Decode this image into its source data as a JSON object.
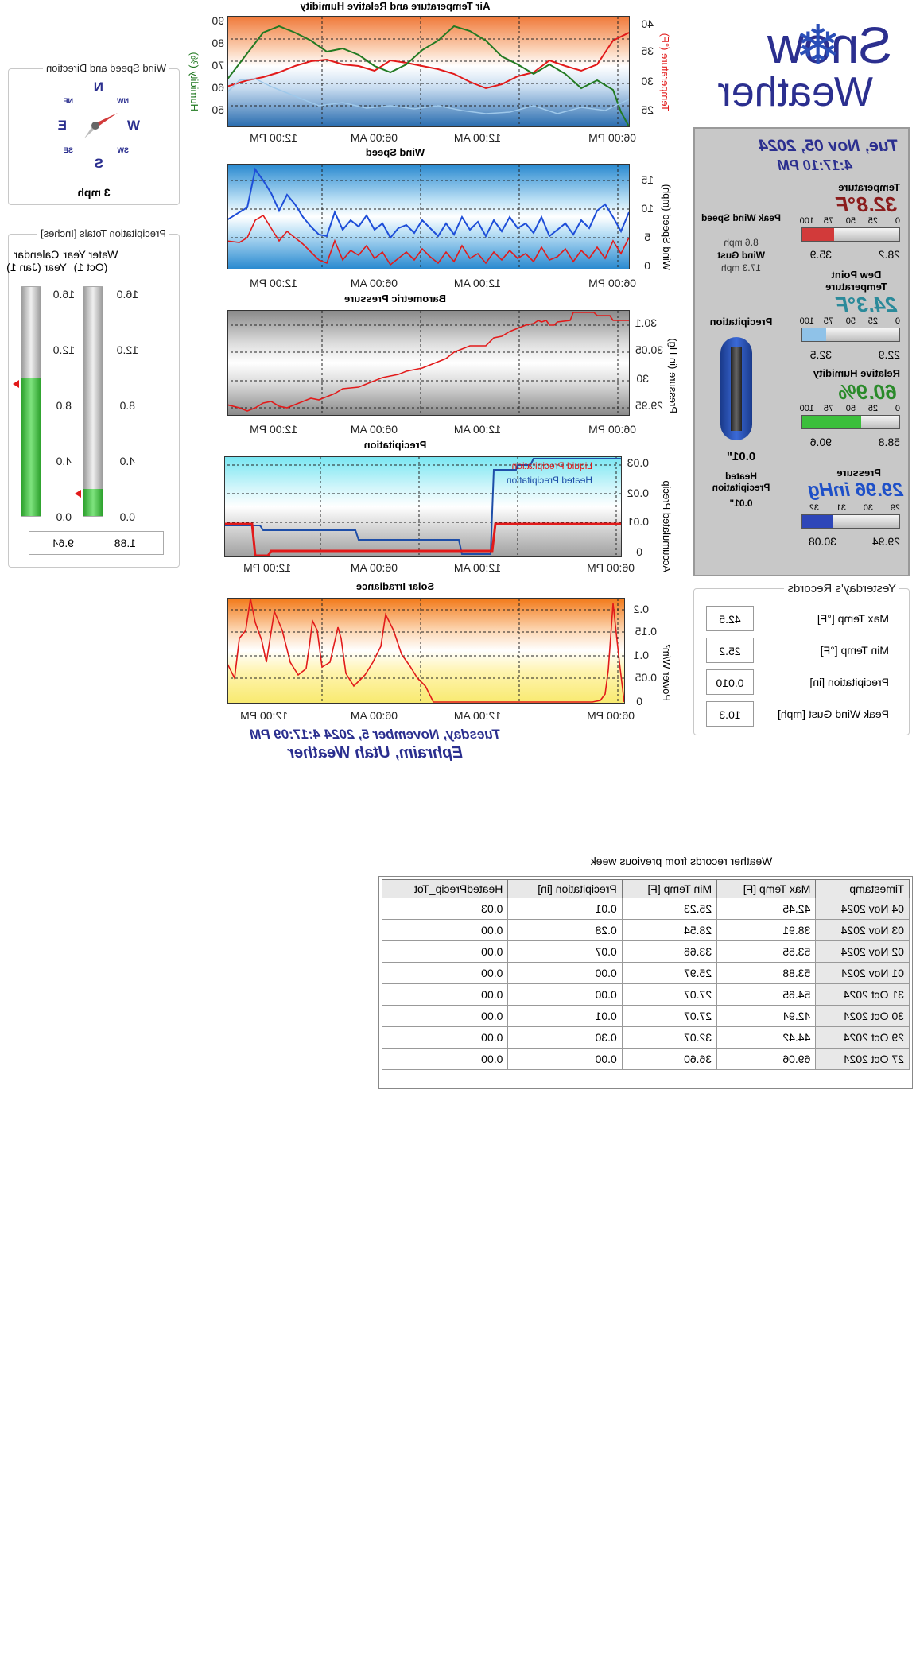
{
  "colors": {
    "navy": "#2b2f8f",
    "temp_red": "#8b1c1c",
    "teal": "#2a8a9a",
    "green": "#2a8a2a",
    "blue": "#1e50c8"
  },
  "logo": {
    "word1": "Snow",
    "word2": "Weather"
  },
  "wind_panel": {
    "title": "Wind Speed and Direction",
    "speed": "3 mph",
    "compass": {
      "n": "N",
      "s": "S",
      "e": "E",
      "w": "W",
      "ne": "NE",
      "nw": "NW",
      "se": "SE",
      "sw": "SW"
    }
  },
  "precip_totals": {
    "title": "Precipitation Totals [Inches]",
    "water_year_label": "Water Year (Oct 1)",
    "calendar_label": "Calendar Year (Jan 1)",
    "ticks": [
      "16.0",
      "12.0",
      "8.0",
      "4.0",
      "0.0"
    ],
    "water_year_value": "1.88",
    "calendar_value": "9.64",
    "water_year_fill": 0.118,
    "calendar_fill": 0.603
  },
  "charts": {
    "temp_title": "Air Temperature and Relative Humidity",
    "temp_left_label": "Temperature (°F)",
    "temp_right_label": "Humidity (%)",
    "temp_left_ticks": [
      "40",
      "35",
      "30",
      "25"
    ],
    "temp_right_ticks": [
      "90",
      "80",
      "70",
      "60",
      "50"
    ],
    "wind_title": "Wind Speed",
    "wind_left_label": "Wind Speed (mph)",
    "wind_left_ticks": [
      "15",
      "10",
      "5",
      "0"
    ],
    "baro_title": "Barometric Pressure",
    "baro_left_label": "Pressure (in Hg)",
    "baro_left_ticks": [
      "30.1",
      "30.05",
      "30",
      "29.95"
    ],
    "precip_title": "Precipitation",
    "precip_left_label": "Accumulated Precip",
    "precip_left_ticks": [
      "0.03",
      "0.02",
      "0.01",
      "0"
    ],
    "precip_legend_liquid": "Liquid Precipitation",
    "precip_legend_heated": "Heated Precipitation",
    "solar_title": "Solar Irradiance",
    "solar_left_label": "Power W/m²",
    "solar_left_ticks": [
      "0.2",
      "0.15",
      "0.1",
      "0.05",
      "0"
    ],
    "time_ticks": [
      "06:00 PM",
      "12:00 AM",
      "06:00 AM",
      "12:00 PM"
    ]
  },
  "footer": {
    "datetime": "Tuesday, November 5, 2024 4:17:09 PM",
    "location": "Ephraim, Utah Weather"
  },
  "current": {
    "date": "Tue, Nov 05, 2024",
    "time": "4:17:10 PM",
    "temperature_label": "Temperature",
    "temperature": "32.8°F",
    "temp_min": "28.2",
    "temp_max": "35.9",
    "gauge_ticks": [
      "0",
      "25",
      "50",
      "75",
      "100"
    ],
    "dewpoint_label": "Dew Point Temperature",
    "dewpoint": "24.3°F",
    "dew_min": "22.9",
    "dew_max": "32.5",
    "humidity_label": "Relative Humidity",
    "humidity": "60.9%",
    "hum_min": "58.8",
    "hum_max": "90.6",
    "pressure_label": "Pressure",
    "pressure": "29.96 inHg",
    "pressure_ticks": [
      "29",
      "30",
      "31",
      "32"
    ],
    "pres_min": "29.94",
    "pres_max": "30.08",
    "peak_wind_label": "Peak Wind Speed",
    "peak_wind": "8.6 mph",
    "wind_gust_label": "Wind Gust",
    "wind_gust": "17.3 mph",
    "precip_label": "Precipitation",
    "precip_value": "0.01\"",
    "heated_label": "Heated Precipitation",
    "heated_value": "0.01\"",
    "temp_fill": 0.328,
    "dew_fill": 0.243,
    "hum_fill": 0.609,
    "pres_fill": 0.32
  },
  "yesterday": {
    "title": "Yesterday's Records",
    "rows": [
      {
        "label": "Max Temp [°F]",
        "value": "42.5"
      },
      {
        "label": "Min Temp [°F]",
        "value": "25.2"
      },
      {
        "label": "Precipitation [in]",
        "value": "0.010"
      },
      {
        "label": "Peak Wind Gust [mph]",
        "value": "10.3"
      }
    ]
  },
  "week_table": {
    "title": "Weather records from previous week",
    "headers": [
      "Timestamp",
      "Max Temp [F]",
      "Min Temp [F]",
      "Precipitation [in]",
      "HeatedPrecip_Tot"
    ],
    "rows": [
      [
        "04 Nov 2024",
        "42.45",
        "25.23",
        "0.01",
        "0.03"
      ],
      [
        "03 Nov 2024",
        "38.91",
        "28.54",
        "0.28",
        "0.00"
      ],
      [
        "02 Nov 2024",
        "53.55",
        "33.66",
        "0.07",
        "0.00"
      ],
      [
        "01 Nov 2024",
        "53.88",
        "25.97",
        "0.00",
        "0.00"
      ],
      [
        "31 Oct 2024",
        "54.65",
        "27.07",
        "0.00",
        "0.00"
      ],
      [
        "30 Oct 2024",
        "42.94",
        "27.07",
        "0.01",
        "0.00"
      ],
      [
        "29 Oct 2024",
        "44.42",
        "32.07",
        "0.30",
        "0.00"
      ],
      [
        "27 Oct 2024",
        "69.06",
        "36.60",
        "0.00",
        "0.00"
      ]
    ]
  }
}
